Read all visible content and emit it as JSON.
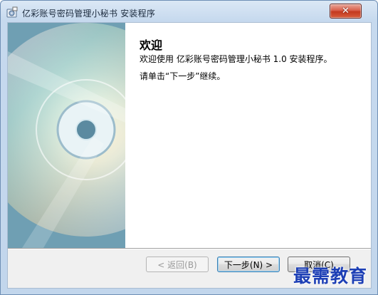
{
  "window": {
    "title": "亿彩账号密码管理小秘书 安装程序",
    "close_label": "✕"
  },
  "welcome": {
    "heading": "欢迎",
    "line1": "欢迎使用 亿彩账号密码管理小秘书 1.0 安装程序。",
    "line2": "请单击“下一步”继续。"
  },
  "buttons": {
    "back": "< 返回(B)",
    "next": "下一步(N) >",
    "cancel": "取消(C)"
  },
  "watermark": "最需教育"
}
